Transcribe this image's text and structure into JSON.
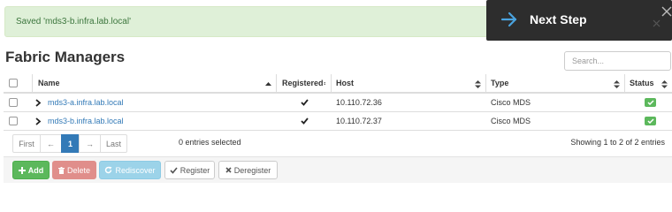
{
  "alert": {
    "message": "Saved 'mds3-b.infra.lab.local'"
  },
  "next_step": {
    "label": "Next Step",
    "arrow_icon": "arrow-right-icon",
    "close_icon": "close-icon"
  },
  "page": {
    "title": "Fabric Managers"
  },
  "search": {
    "placeholder": "Search..."
  },
  "table": {
    "columns": {
      "name": "Name",
      "registered": "Registered",
      "host": "Host",
      "type": "Type",
      "status": "Status"
    },
    "rows": [
      {
        "name": "mds3-a.infra.lab.local",
        "registered": true,
        "host": "10.110.72.36",
        "type": "Cisco MDS",
        "status": "ok"
      },
      {
        "name": "mds3-b.infra.lab.local",
        "registered": true,
        "host": "10.110.72.37",
        "type": "Cisco MDS",
        "status": "ok"
      }
    ]
  },
  "pagination": {
    "first": "First",
    "prev": "←",
    "current": "1",
    "next": "→",
    "last": "Last"
  },
  "selection": {
    "text": "0 entries selected"
  },
  "summary": {
    "text": "Showing 1 to 2 of 2 entries"
  },
  "toolbar": {
    "add": "Add",
    "delete": "Delete",
    "rediscover": "Rediscover",
    "register": "Register",
    "deregister": "Deregister"
  },
  "colors": {
    "success": "#5cb85c",
    "danger_disabled": "#e08e8b",
    "info_disabled": "#9cd3e9",
    "primary": "#337ab7",
    "alert_bg": "#dff0d8",
    "alert_text": "#3c763d",
    "next_step_bg": "#2d2d2d"
  }
}
